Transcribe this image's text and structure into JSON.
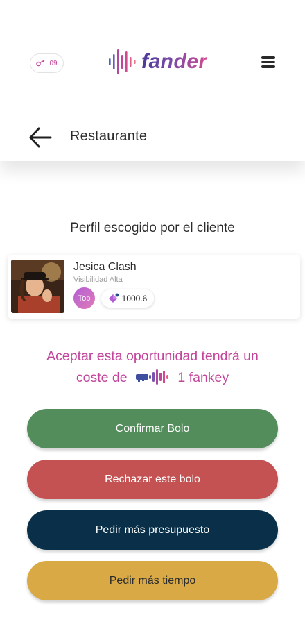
{
  "header": {
    "fankeys_count": "09",
    "logo_text": "fander",
    "menu_icon": "hamburger-menu-icon"
  },
  "page": {
    "back_icon": "arrow-left-icon",
    "title": "Restaurante"
  },
  "section": {
    "title": "Perfil escogido por el cliente"
  },
  "profile": {
    "name": "Jesica Clash",
    "visibility": "Visibilidad Alta",
    "badge": "Top",
    "rating": "1000.6",
    "rating_icon": "gem-icon"
  },
  "cost": {
    "line1": "Aceptar esta oportunidad tendrá un",
    "line2_prefix": "coste de",
    "line2_amount": "1 fankey",
    "color": "#c2449b"
  },
  "actions": {
    "confirm": "Confirmar Bolo",
    "reject": "Rechazar este bolo",
    "budget": "Pedir más presupuesto",
    "time": "Pedir más tiempo"
  },
  "colors": {
    "confirm": "#538d5b",
    "reject": "#c55252",
    "budget": "#093048",
    "time": "#d9a946"
  }
}
